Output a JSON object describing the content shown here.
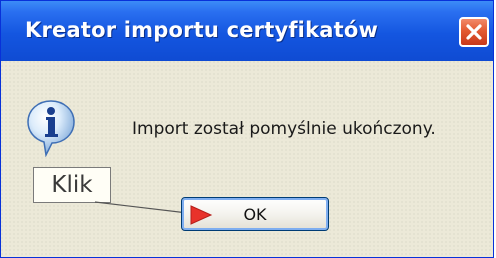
{
  "window": {
    "title": "Kreator importu certyfikatów"
  },
  "dialog": {
    "message": "Import został pomyślnie ukończony.",
    "ok_label": "OK",
    "icon": "info-icon"
  },
  "annotation": {
    "callout_text": "Klik",
    "arrow_icon": "red-arrow-icon"
  },
  "colors": {
    "titlebar": "#1456e0",
    "close_button": "#e35a32",
    "dialog_background": "#ece9d8",
    "arrow": "#e8322a"
  }
}
